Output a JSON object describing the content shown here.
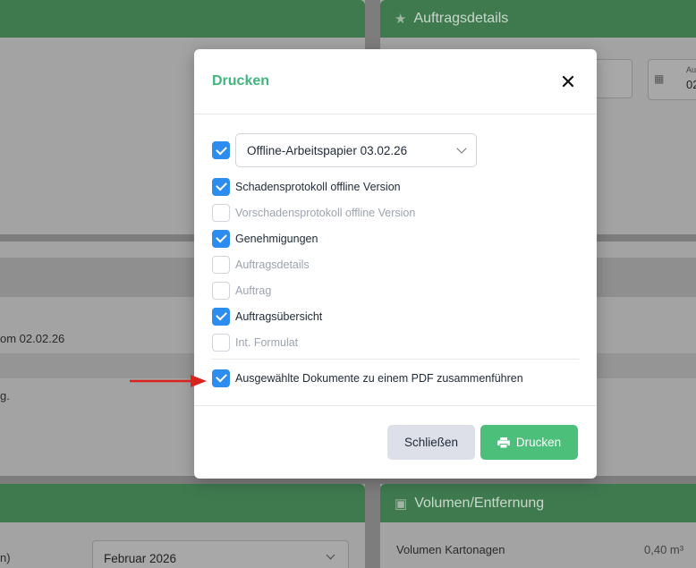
{
  "background": {
    "top_right_header": "Auftragsdetails",
    "top_right_field_label": "Au",
    "top_right_field_value": "02",
    "left_text_1": "om 02.02.26",
    "left_text_2": "g.",
    "bottom_left_select": "Februar 2026",
    "bottom_left_text": "n)",
    "bottom_right_header": "Volumen/Entfernung",
    "volume_label": "Volumen Kartonagen",
    "volume_value": "0,40 m³"
  },
  "modal": {
    "title": "Drucken",
    "select_value": "Offline-Arbeitspapier 03.02.26",
    "items": [
      {
        "label": "Schadensprotokoll offline Version",
        "checked": true
      },
      {
        "label": "Vorschadensprotokoll offline Version",
        "checked": false
      },
      {
        "label": "Genehmigungen",
        "checked": true
      },
      {
        "label": "Auftragsdetails",
        "checked": false
      },
      {
        "label": "Auftrag",
        "checked": false
      },
      {
        "label": "Auftragsübersicht",
        "checked": true
      },
      {
        "label": "Int. Formulat",
        "checked": false
      }
    ],
    "merge_label": "Ausgewählte Dokumente zu einem PDF zusammenführen",
    "close_label": "Schließen",
    "print_label": "Drucken"
  },
  "colors": {
    "accent_green": "#4cc07b",
    "checkbox_blue": "#2d8cf0",
    "arrow_red": "#d9231d"
  }
}
